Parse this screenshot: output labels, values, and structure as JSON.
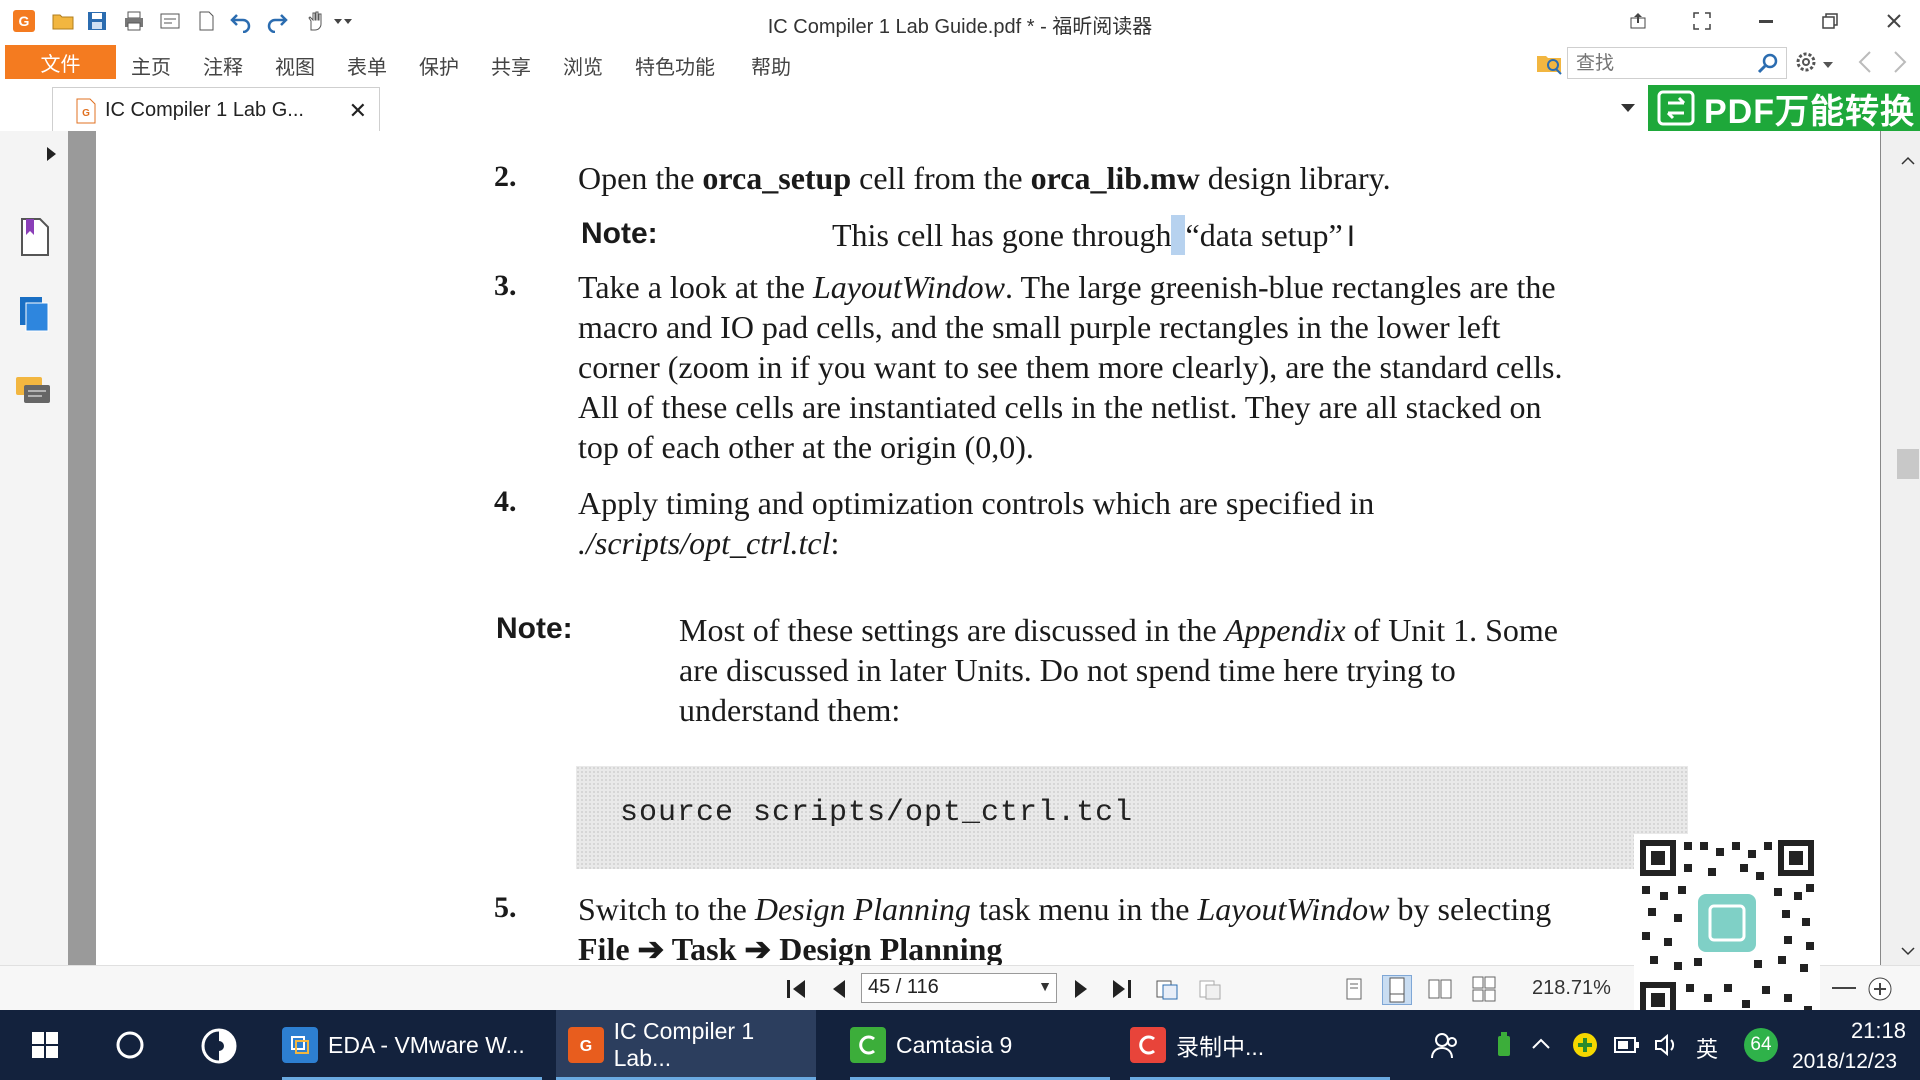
{
  "window": {
    "title": "IC Compiler 1 Lab Guide.pdf * - 福昕阅读器"
  },
  "menu": {
    "file": "文件",
    "items": [
      "主页",
      "注释",
      "视图",
      "表单",
      "保护",
      "共享",
      "浏览",
      "特色功能",
      "帮助"
    ],
    "search_placeholder": "查找"
  },
  "tab": {
    "label": "IC Compiler 1 Lab G...",
    "close": "✕"
  },
  "banner": {
    "text": "PDF万能转换"
  },
  "document": {
    "steps": [
      {
        "number": "2.",
        "segments": [
          {
            "t": "Open the ",
            "s": ""
          },
          {
            "t": "orca_setup",
            "s": "b"
          },
          {
            "t": " cell from the ",
            "s": ""
          },
          {
            "t": "orca_lib.mw",
            "s": "b"
          },
          {
            "t": " design library.",
            "s": ""
          }
        ],
        "note_label": "Note:",
        "note_text_before": "This cell has gone through",
        "note_text_selected": " ",
        "note_text_after": "“data setup”"
      },
      {
        "number": "3.",
        "lines": [
          [
            {
              "t": "Take a look at the ",
              "s": ""
            },
            {
              "t": "LayoutWindow",
              "s": "i"
            },
            {
              "t": ". The large greenish-blue rectangles are the",
              "s": ""
            }
          ],
          [
            {
              "t": "macro and IO pad cells, and the small purple rectangles in the lower left",
              "s": ""
            }
          ],
          [
            {
              "t": "corner (zoom in if you want to see them more clearly), are the standard cells.",
              "s": ""
            }
          ],
          [
            {
              "t": "All of these cells are instantiated cells in the netlist. They are all stacked on",
              "s": ""
            }
          ],
          [
            {
              "t": "top of each other at the origin (0,0).",
              "s": ""
            }
          ]
        ]
      },
      {
        "number": "4.",
        "lines": [
          [
            {
              "t": "Apply timing and optimization controls which are specified in",
              "s": ""
            }
          ],
          [
            {
              "t": "./scripts/opt_ctrl.tcl",
              "s": "i"
            },
            {
              "t": ":",
              "s": ""
            }
          ]
        ]
      },
      {
        "note_label": "Note:",
        "lines": [
          [
            {
              "t": "Most of these settings are discussed in the ",
              "s": ""
            },
            {
              "t": "Appendix",
              "s": "i"
            },
            {
              "t": " of Unit 1. Some",
              "s": ""
            }
          ],
          [
            {
              "t": "are discussed in later Units. Do not spend time here trying to",
              "s": ""
            }
          ],
          [
            {
              "t": "understand them:",
              "s": ""
            }
          ]
        ]
      },
      {
        "code": "source scripts/opt_ctrl.tcl"
      },
      {
        "number": "5.",
        "lines": [
          [
            {
              "t": "Switch to the ",
              "s": ""
            },
            {
              "t": "Design Planning",
              "s": "i"
            },
            {
              "t": " task menu in the ",
              "s": ""
            },
            {
              "t": "LayoutWindow",
              "s": "i"
            },
            {
              "t": " by selecting",
              "s": ""
            }
          ],
          [
            {
              "t": "File ➔ Task ➔ Design Planning",
              "s": "b"
            }
          ]
        ]
      }
    ]
  },
  "nav": {
    "page_value": "45 / 116",
    "zoom": "218.71%"
  },
  "taskbar": {
    "items": [
      {
        "label": "EDA - VMware W...",
        "color": "#2d7fd1"
      },
      {
        "label": "IC Compiler 1 Lab...",
        "color": "#e85d1e"
      },
      {
        "label": "Camtasia 9",
        "color": "#3cae3a"
      },
      {
        "label": "录制中...",
        "color": "#e8443a"
      }
    ],
    "tray_lang": "英",
    "tray_badge": "64",
    "time": "21:18",
    "date": "2018/12/23"
  }
}
